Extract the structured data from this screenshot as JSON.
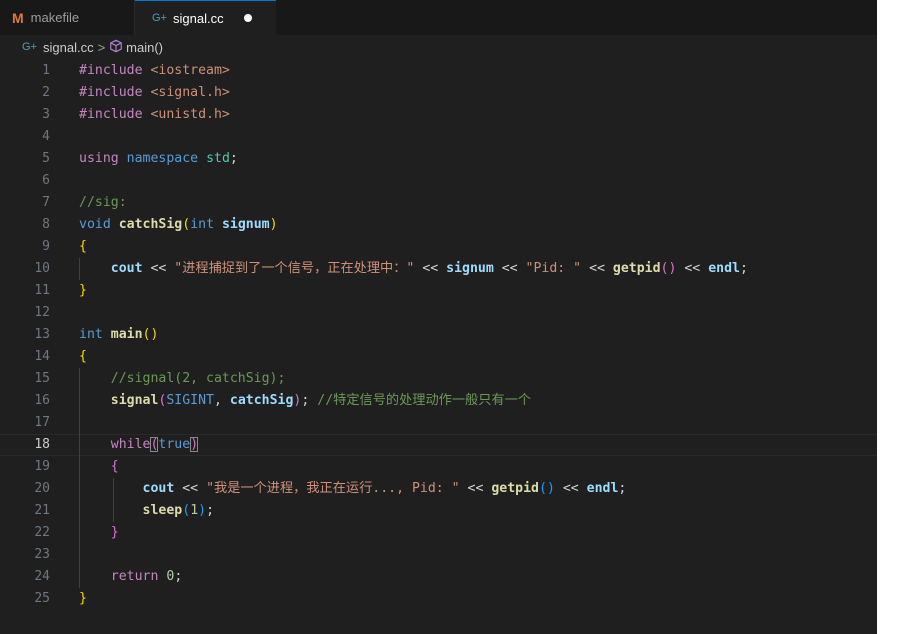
{
  "tabs": [
    {
      "label": "makefile",
      "icon": "M",
      "active": false
    },
    {
      "label": "signal.cc",
      "icon": "G+",
      "active": true,
      "modified": true
    }
  ],
  "breadcrumb": {
    "file": "signal.cc",
    "symbol": "main()"
  },
  "editor": {
    "current_line": 18,
    "lines": [
      {
        "n": "1",
        "tokens": [
          [
            "pp",
            "#include <iostream>"
          ]
        ]
      },
      {
        "n": "2",
        "tokens": [
          [
            "pp",
            "#include <signal.h>"
          ]
        ]
      },
      {
        "n": "3",
        "tokens": [
          [
            "pp",
            "#include <unistd.h>"
          ]
        ]
      },
      {
        "n": "4",
        "tokens": []
      },
      {
        "n": "5",
        "tokens": [
          [
            "ctl",
            "using"
          ],
          [
            "op",
            " "
          ],
          [
            "kw",
            "namespace"
          ],
          [
            "op",
            " "
          ],
          [
            "ns",
            "std"
          ],
          [
            "op",
            ";"
          ]
        ]
      },
      {
        "n": "6",
        "tokens": []
      },
      {
        "n": "7",
        "tokens": [
          [
            "cmt",
            "//sig:"
          ]
        ]
      },
      {
        "n": "8",
        "tokens": [
          [
            "kw",
            "void"
          ],
          [
            "op",
            " "
          ],
          [
            "fn",
            "catchSig"
          ],
          [
            "b1",
            "("
          ],
          [
            "kw",
            "int"
          ],
          [
            "op",
            " "
          ],
          [
            "var",
            "signum"
          ],
          [
            "b1",
            ")"
          ]
        ]
      },
      {
        "n": "9",
        "tokens": [
          [
            "b1",
            "{"
          ]
        ]
      },
      {
        "n": "10",
        "tokens": [
          [
            "op",
            "    "
          ],
          [
            "var",
            "cout"
          ],
          [
            "op",
            " << "
          ],
          [
            "str",
            "\"进程捕捉到了一个信号，正在处理中：\""
          ],
          [
            "op",
            " << "
          ],
          [
            "var",
            "signum"
          ],
          [
            "op",
            " << "
          ],
          [
            "str",
            "\"Pid: \""
          ],
          [
            "op",
            " << "
          ],
          [
            "fn",
            "getpid"
          ],
          [
            "b2",
            "()"
          ],
          [
            "op",
            " << "
          ],
          [
            "var",
            "endl"
          ],
          [
            "op",
            ";"
          ]
        ]
      },
      {
        "n": "11",
        "tokens": [
          [
            "b1",
            "}"
          ]
        ]
      },
      {
        "n": "12",
        "tokens": []
      },
      {
        "n": "13",
        "tokens": [
          [
            "kw",
            "int"
          ],
          [
            "op",
            " "
          ],
          [
            "fn",
            "main"
          ],
          [
            "b1",
            "()"
          ]
        ]
      },
      {
        "n": "14",
        "tokens": [
          [
            "b1",
            "{"
          ]
        ]
      },
      {
        "n": "15",
        "tokens": [
          [
            "op",
            "    "
          ],
          [
            "cmt",
            "//signal(2, catchSig);"
          ]
        ]
      },
      {
        "n": "16",
        "tokens": [
          [
            "op",
            "    "
          ],
          [
            "fn",
            "signal"
          ],
          [
            "b2",
            "("
          ],
          [
            "kw",
            "SIGINT"
          ],
          [
            "op",
            ", "
          ],
          [
            "var",
            "catchSig"
          ],
          [
            "b2",
            ")"
          ],
          [
            "op",
            "; "
          ],
          [
            "cmt",
            "//特定信号的处理动作一般只有一个"
          ]
        ]
      },
      {
        "n": "17",
        "tokens": []
      },
      {
        "n": "18",
        "tokens": [
          [
            "op",
            "    "
          ],
          [
            "ctl",
            "while"
          ],
          [
            "b2m",
            "("
          ],
          [
            "kw",
            "true"
          ],
          [
            "b2m",
            ")"
          ]
        ]
      },
      {
        "n": "19",
        "tokens": [
          [
            "op",
            "    "
          ],
          [
            "b2",
            "{"
          ]
        ]
      },
      {
        "n": "20",
        "tokens": [
          [
            "op",
            "        "
          ],
          [
            "var",
            "cout"
          ],
          [
            "op",
            " << "
          ],
          [
            "str",
            "\"我是一个进程，我正在运行..., Pid: \""
          ],
          [
            "op",
            " << "
          ],
          [
            "fn",
            "getpid"
          ],
          [
            "b3",
            "()"
          ],
          [
            "op",
            " << "
          ],
          [
            "var",
            "endl"
          ],
          [
            "op",
            ";"
          ]
        ]
      },
      {
        "n": "21",
        "tokens": [
          [
            "op",
            "        "
          ],
          [
            "fn",
            "sleep"
          ],
          [
            "b3",
            "("
          ],
          [
            "num",
            "1"
          ],
          [
            "b3",
            ")"
          ],
          [
            "op",
            ";"
          ]
        ]
      },
      {
        "n": "22",
        "tokens": [
          [
            "op",
            "    "
          ],
          [
            "b2",
            "}"
          ]
        ]
      },
      {
        "n": "23",
        "tokens": []
      },
      {
        "n": "24",
        "tokens": [
          [
            "op",
            "    "
          ],
          [
            "ctl",
            "return"
          ],
          [
            "op",
            " "
          ],
          [
            "num",
            "0"
          ],
          [
            "op",
            ";"
          ]
        ]
      },
      {
        "n": "25",
        "tokens": [
          [
            "b1",
            "}"
          ]
        ]
      }
    ]
  },
  "colors": {
    "editor_bg": "#1f1f1f",
    "tabbar_bg": "#181818",
    "active_tab_accent": "#0078d4",
    "keyword": "#569cd6",
    "control": "#c586c0",
    "function": "#dcdcaa",
    "variable": "#9cdcfe",
    "string": "#ce9178",
    "comment": "#6a9955",
    "number": "#b5cea8"
  },
  "icons": [
    "makefile-m-icon",
    "cpp-file-icon",
    "modified-dot-icon",
    "chevron-right-icon",
    "symbol-cube-icon"
  ]
}
